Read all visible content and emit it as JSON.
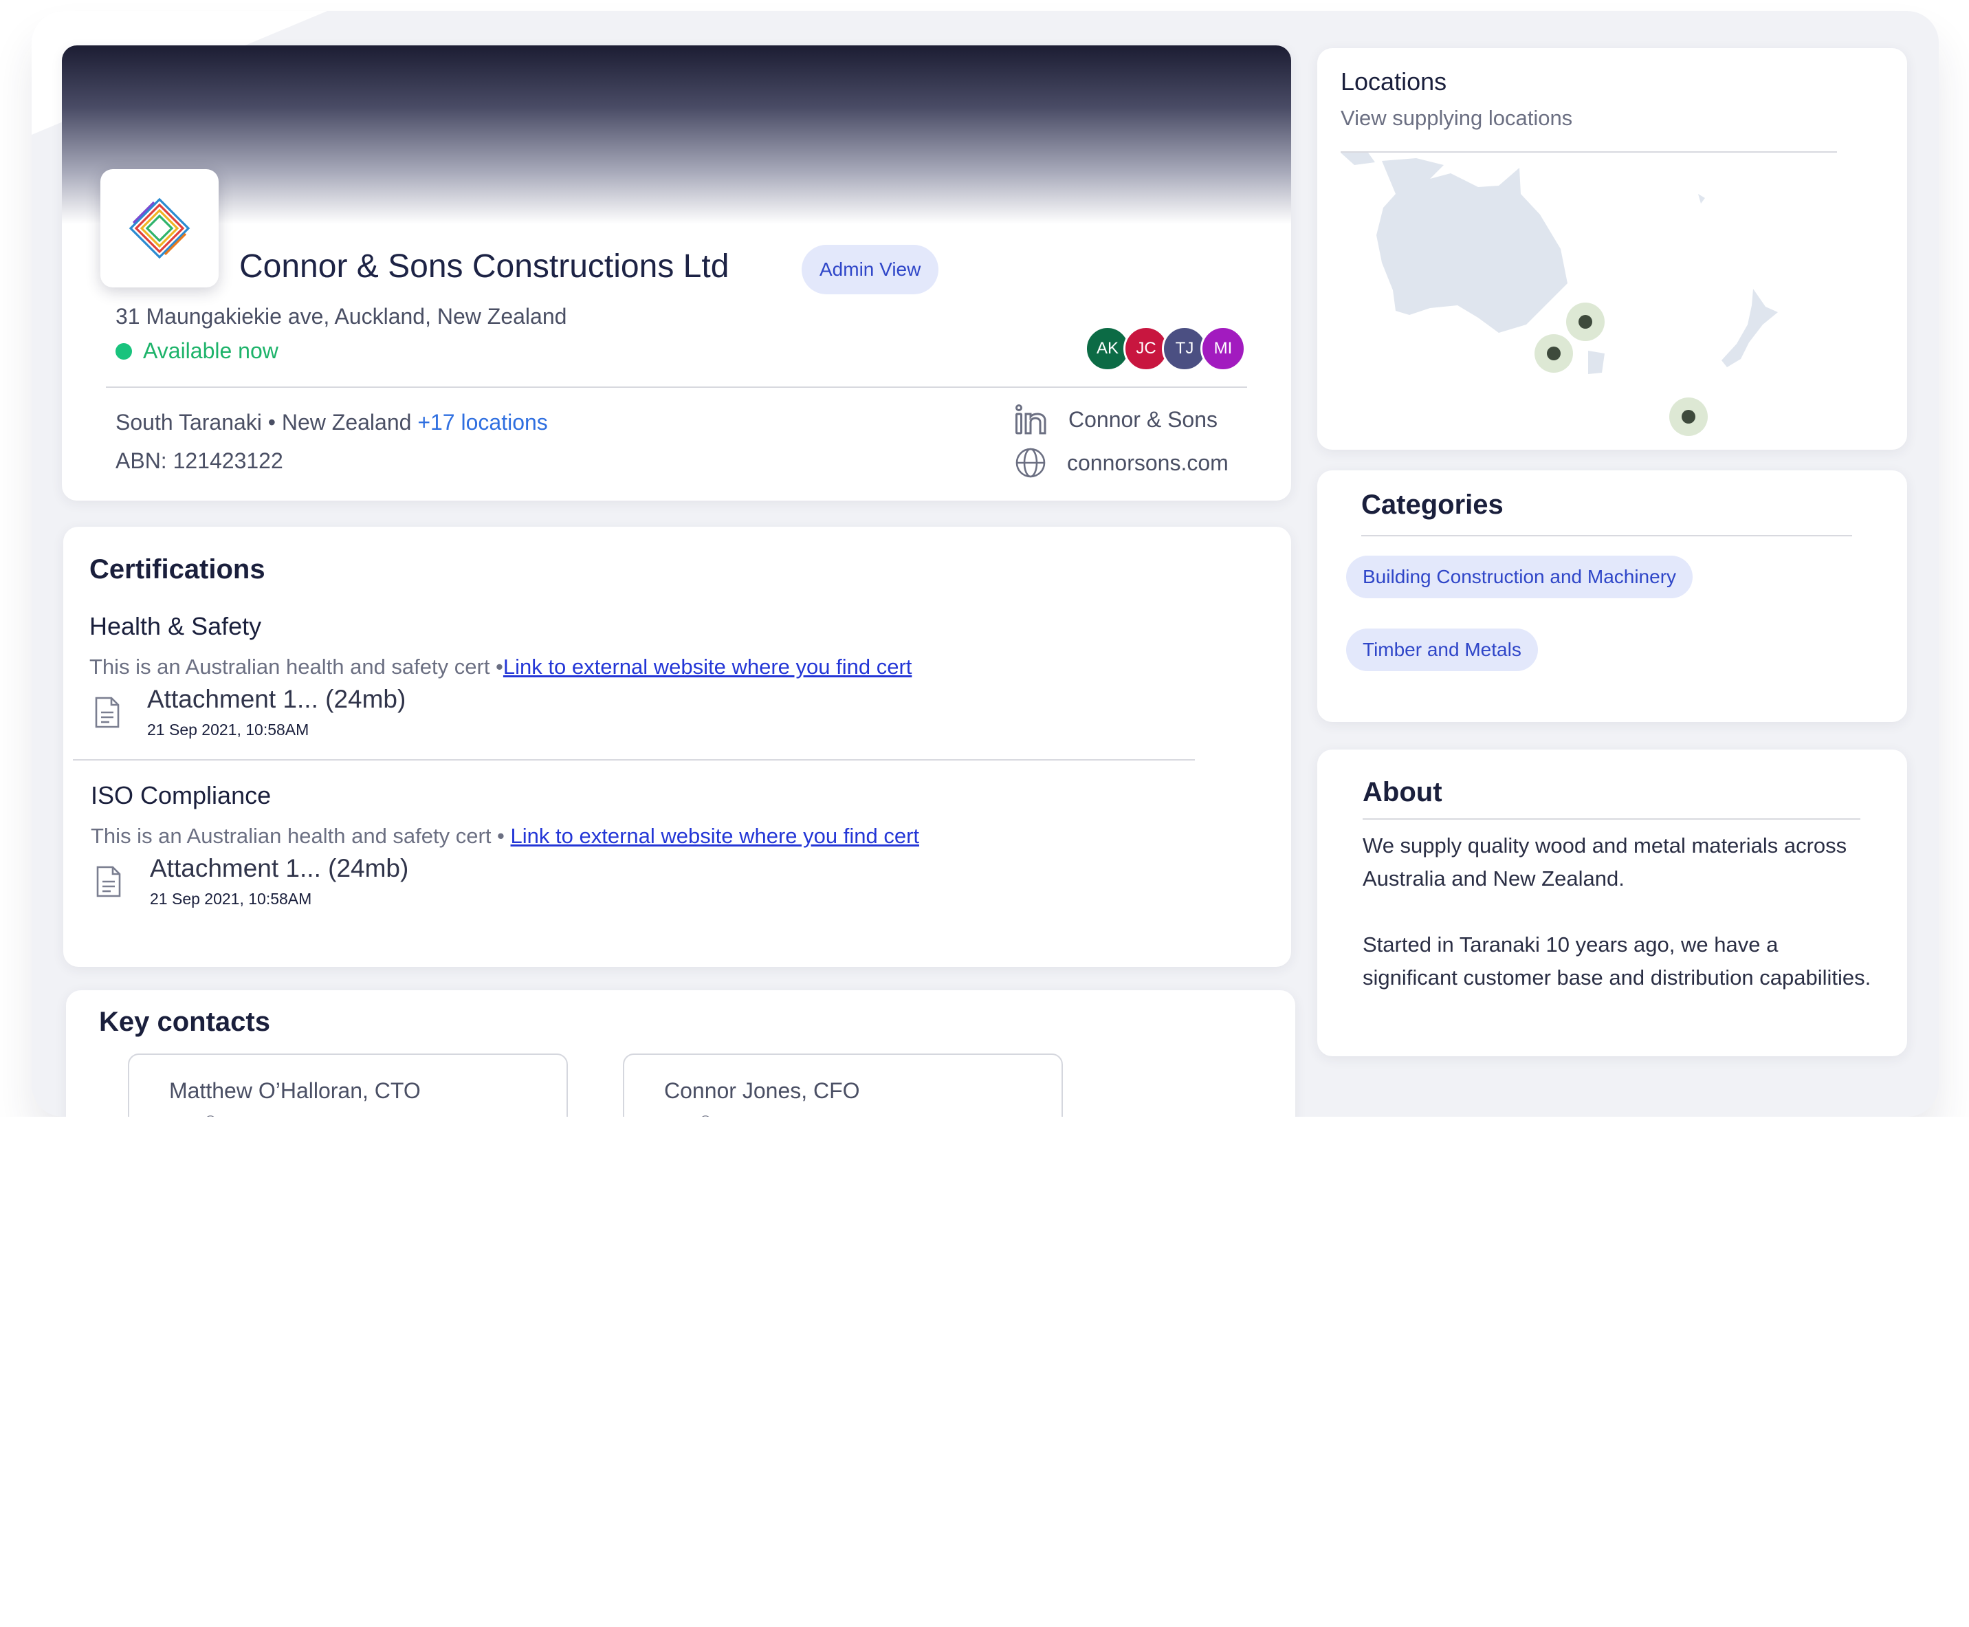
{
  "company": {
    "name": "Connor & Sons Constructions Ltd",
    "admin_label": "Admin View",
    "address": "31 Maungakiekie ave, Auckland, New Zealand",
    "availability": "Available now",
    "region": "South Taranaki • New Zealand",
    "more_locations": "+17 locations",
    "abn": "ABN: 121423122",
    "linkedin": "Connor & Sons",
    "website": "connorsons.com",
    "avatars": [
      {
        "initials": "AK",
        "color": "#0c6b45"
      },
      {
        "initials": "JC",
        "color": "#c8163f"
      },
      {
        "initials": "TJ",
        "color": "#4b4f82"
      },
      {
        "initials": "MI",
        "color": "#a21bbf"
      }
    ]
  },
  "certifications": {
    "title": "Certifications",
    "items": [
      {
        "heading": "Health & Safety",
        "description": "This is an Australian health and safety cert •",
        "link": "Link to external website where you find cert",
        "attachment": "Attachment 1... (24mb)",
        "date": "21 Sep 2021, 10:58AM"
      },
      {
        "heading": "ISO Compliance",
        "description": "This is an Australian health and safety cert •",
        "link": "Link to external website where you find cert",
        "attachment": "Attachment 1... (24mb)",
        "date": "21 Sep 2021, 10:58AM"
      }
    ]
  },
  "contacts": {
    "title": "Key contacts",
    "items": [
      {
        "name": "Matthew O’Halloran, CTO"
      },
      {
        "name": "Connor Jones, CFO"
      }
    ]
  },
  "locations": {
    "title": "Locations",
    "subtitle": "View supplying locations"
  },
  "categories": {
    "title": "Categories",
    "items": [
      "Building Construction and Machinery",
      "Timber and Metals"
    ]
  },
  "about": {
    "title": "About",
    "paragraphs": [
      "We supply quality wood and metal materials across Australia and New Zealand.",
      "Started in Taranaki 10 years ago, we have a significant customer base and distribution capabilities."
    ]
  },
  "colors": {
    "accent": "#2f46c8",
    "link": "#2336d6",
    "available": "#19c37d",
    "pill_bg": "#e3e8fb"
  }
}
